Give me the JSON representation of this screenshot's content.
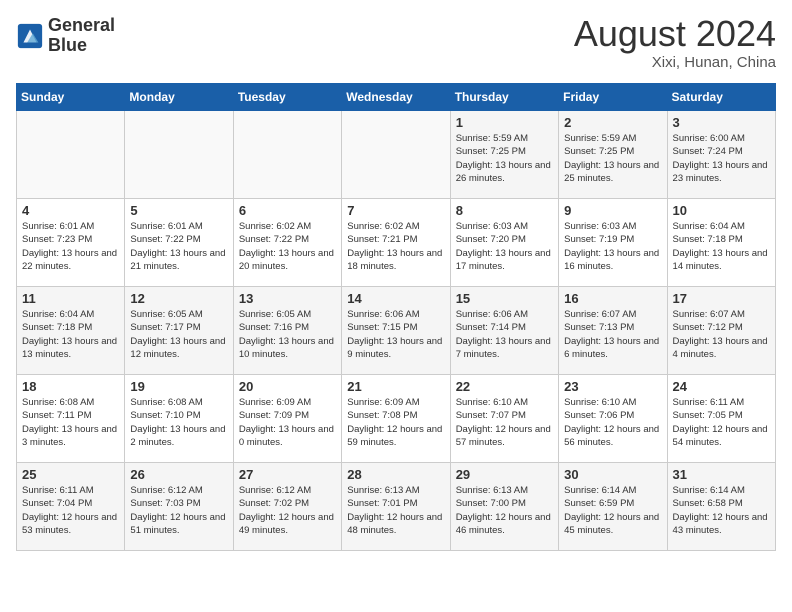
{
  "header": {
    "logo_line1": "General",
    "logo_line2": "Blue",
    "month_year": "August 2024",
    "location": "Xixi, Hunan, China"
  },
  "days_of_week": [
    "Sunday",
    "Monday",
    "Tuesday",
    "Wednesday",
    "Thursday",
    "Friday",
    "Saturday"
  ],
  "weeks": [
    [
      {
        "day": "",
        "info": ""
      },
      {
        "day": "",
        "info": ""
      },
      {
        "day": "",
        "info": ""
      },
      {
        "day": "",
        "info": ""
      },
      {
        "day": "1",
        "info": "Sunrise: 5:59 AM\nSunset: 7:25 PM\nDaylight: 13 hours\nand 26 minutes."
      },
      {
        "day": "2",
        "info": "Sunrise: 5:59 AM\nSunset: 7:25 PM\nDaylight: 13 hours\nand 25 minutes."
      },
      {
        "day": "3",
        "info": "Sunrise: 6:00 AM\nSunset: 7:24 PM\nDaylight: 13 hours\nand 23 minutes."
      }
    ],
    [
      {
        "day": "4",
        "info": "Sunrise: 6:01 AM\nSunset: 7:23 PM\nDaylight: 13 hours\nand 22 minutes."
      },
      {
        "day": "5",
        "info": "Sunrise: 6:01 AM\nSunset: 7:22 PM\nDaylight: 13 hours\nand 21 minutes."
      },
      {
        "day": "6",
        "info": "Sunrise: 6:02 AM\nSunset: 7:22 PM\nDaylight: 13 hours\nand 20 minutes."
      },
      {
        "day": "7",
        "info": "Sunrise: 6:02 AM\nSunset: 7:21 PM\nDaylight: 13 hours\nand 18 minutes."
      },
      {
        "day": "8",
        "info": "Sunrise: 6:03 AM\nSunset: 7:20 PM\nDaylight: 13 hours\nand 17 minutes."
      },
      {
        "day": "9",
        "info": "Sunrise: 6:03 AM\nSunset: 7:19 PM\nDaylight: 13 hours\nand 16 minutes."
      },
      {
        "day": "10",
        "info": "Sunrise: 6:04 AM\nSunset: 7:18 PM\nDaylight: 13 hours\nand 14 minutes."
      }
    ],
    [
      {
        "day": "11",
        "info": "Sunrise: 6:04 AM\nSunset: 7:18 PM\nDaylight: 13 hours\nand 13 minutes."
      },
      {
        "day": "12",
        "info": "Sunrise: 6:05 AM\nSunset: 7:17 PM\nDaylight: 13 hours\nand 12 minutes."
      },
      {
        "day": "13",
        "info": "Sunrise: 6:05 AM\nSunset: 7:16 PM\nDaylight: 13 hours\nand 10 minutes."
      },
      {
        "day": "14",
        "info": "Sunrise: 6:06 AM\nSunset: 7:15 PM\nDaylight: 13 hours\nand 9 minutes."
      },
      {
        "day": "15",
        "info": "Sunrise: 6:06 AM\nSunset: 7:14 PM\nDaylight: 13 hours\nand 7 minutes."
      },
      {
        "day": "16",
        "info": "Sunrise: 6:07 AM\nSunset: 7:13 PM\nDaylight: 13 hours\nand 6 minutes."
      },
      {
        "day": "17",
        "info": "Sunrise: 6:07 AM\nSunset: 7:12 PM\nDaylight: 13 hours\nand 4 minutes."
      }
    ],
    [
      {
        "day": "18",
        "info": "Sunrise: 6:08 AM\nSunset: 7:11 PM\nDaylight: 13 hours\nand 3 minutes."
      },
      {
        "day": "19",
        "info": "Sunrise: 6:08 AM\nSunset: 7:10 PM\nDaylight: 13 hours\nand 2 minutes."
      },
      {
        "day": "20",
        "info": "Sunrise: 6:09 AM\nSunset: 7:09 PM\nDaylight: 13 hours\nand 0 minutes."
      },
      {
        "day": "21",
        "info": "Sunrise: 6:09 AM\nSunset: 7:08 PM\nDaylight: 12 hours\nand 59 minutes."
      },
      {
        "day": "22",
        "info": "Sunrise: 6:10 AM\nSunset: 7:07 PM\nDaylight: 12 hours\nand 57 minutes."
      },
      {
        "day": "23",
        "info": "Sunrise: 6:10 AM\nSunset: 7:06 PM\nDaylight: 12 hours\nand 56 minutes."
      },
      {
        "day": "24",
        "info": "Sunrise: 6:11 AM\nSunset: 7:05 PM\nDaylight: 12 hours\nand 54 minutes."
      }
    ],
    [
      {
        "day": "25",
        "info": "Sunrise: 6:11 AM\nSunset: 7:04 PM\nDaylight: 12 hours\nand 53 minutes."
      },
      {
        "day": "26",
        "info": "Sunrise: 6:12 AM\nSunset: 7:03 PM\nDaylight: 12 hours\nand 51 minutes."
      },
      {
        "day": "27",
        "info": "Sunrise: 6:12 AM\nSunset: 7:02 PM\nDaylight: 12 hours\nand 49 minutes."
      },
      {
        "day": "28",
        "info": "Sunrise: 6:13 AM\nSunset: 7:01 PM\nDaylight: 12 hours\nand 48 minutes."
      },
      {
        "day": "29",
        "info": "Sunrise: 6:13 AM\nSunset: 7:00 PM\nDaylight: 12 hours\nand 46 minutes."
      },
      {
        "day": "30",
        "info": "Sunrise: 6:14 AM\nSunset: 6:59 PM\nDaylight: 12 hours\nand 45 minutes."
      },
      {
        "day": "31",
        "info": "Sunrise: 6:14 AM\nSunset: 6:58 PM\nDaylight: 12 hours\nand 43 minutes."
      }
    ]
  ]
}
